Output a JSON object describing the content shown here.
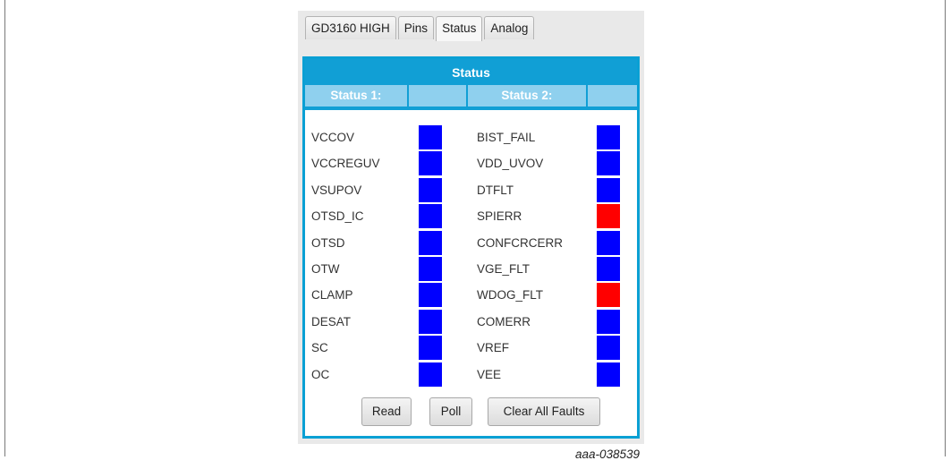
{
  "tabs": [
    {
      "label": "GD3160 HIGH"
    },
    {
      "label": "Pins"
    },
    {
      "label": "Status"
    },
    {
      "label": "Analog"
    }
  ],
  "active_tab": "Status",
  "panel": {
    "title": "Status",
    "column1_header": "Status 1:",
    "column2_header": "Status 2:"
  },
  "colors": {
    "ok": "#0000ff",
    "fault": "#ff0000"
  },
  "status1": [
    {
      "label": "VCCOV",
      "state": "ok"
    },
    {
      "label": "VCCREGUV",
      "state": "ok"
    },
    {
      "label": "VSUPOV",
      "state": "ok"
    },
    {
      "label": "OTSD_IC",
      "state": "ok"
    },
    {
      "label": "OTSD",
      "state": "ok"
    },
    {
      "label": "OTW",
      "state": "ok"
    },
    {
      "label": "CLAMP",
      "state": "ok"
    },
    {
      "label": "DESAT",
      "state": "ok"
    },
    {
      "label": "SC",
      "state": "ok"
    },
    {
      "label": "OC",
      "state": "ok"
    }
  ],
  "status2": [
    {
      "label": "BIST_FAIL",
      "state": "ok"
    },
    {
      "label": "VDD_UVOV",
      "state": "ok"
    },
    {
      "label": "DTFLT",
      "state": "ok"
    },
    {
      "label": "SPIERR",
      "state": "fault"
    },
    {
      "label": "CONFCRCERR",
      "state": "ok"
    },
    {
      "label": "VGE_FLT",
      "state": "ok"
    },
    {
      "label": "WDOG_FLT",
      "state": "fault"
    },
    {
      "label": "COMERR",
      "state": "ok"
    },
    {
      "label": "VREF",
      "state": "ok"
    },
    {
      "label": "VEE",
      "state": "ok"
    }
  ],
  "buttons": {
    "read": "Read",
    "poll": "Poll",
    "clear": "Clear All Faults"
  },
  "caption": "aaa-038539"
}
